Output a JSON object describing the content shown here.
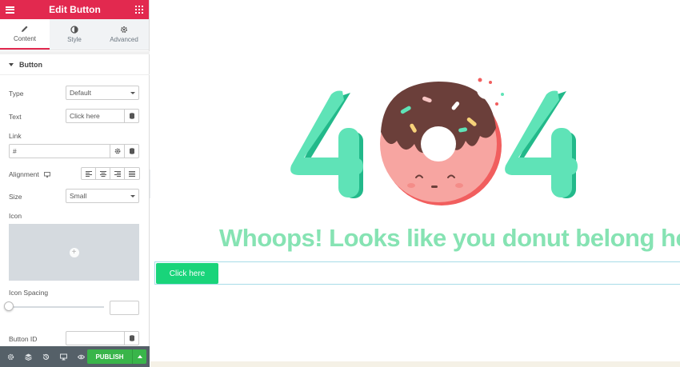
{
  "header": {
    "title": "Edit Button"
  },
  "tabs": [
    {
      "label": "Content",
      "icon": "pencil-icon"
    },
    {
      "label": "Style",
      "icon": "contrast-icon"
    },
    {
      "label": "Advanced",
      "icon": "gear-icon"
    }
  ],
  "section": {
    "title": "Button"
  },
  "form": {
    "type_label": "Type",
    "type_value": "Default",
    "text_label": "Text",
    "text_value": "Click here",
    "link_label": "Link",
    "link_value": "#",
    "alignment_label": "Alignment",
    "size_label": "Size",
    "size_value": "Small",
    "icon_label": "Icon",
    "icon_spacing_label": "Icon Spacing",
    "button_id_label": "Button ID"
  },
  "footer": {
    "publish_label": "PUBLISH"
  },
  "preview": {
    "headline": "Whoops! Looks like you donut belong here",
    "button_label": "Click here",
    "hero_digits": [
      "4",
      "4"
    ]
  },
  "colors": {
    "accent": "#e2294f",
    "publish": "#39b54a",
    "cta": "#19d47a",
    "headline": "#86e3b3",
    "digit": "#5fe3b7",
    "donut": "#f7a5a1",
    "frosting": "#6b3f3a"
  }
}
